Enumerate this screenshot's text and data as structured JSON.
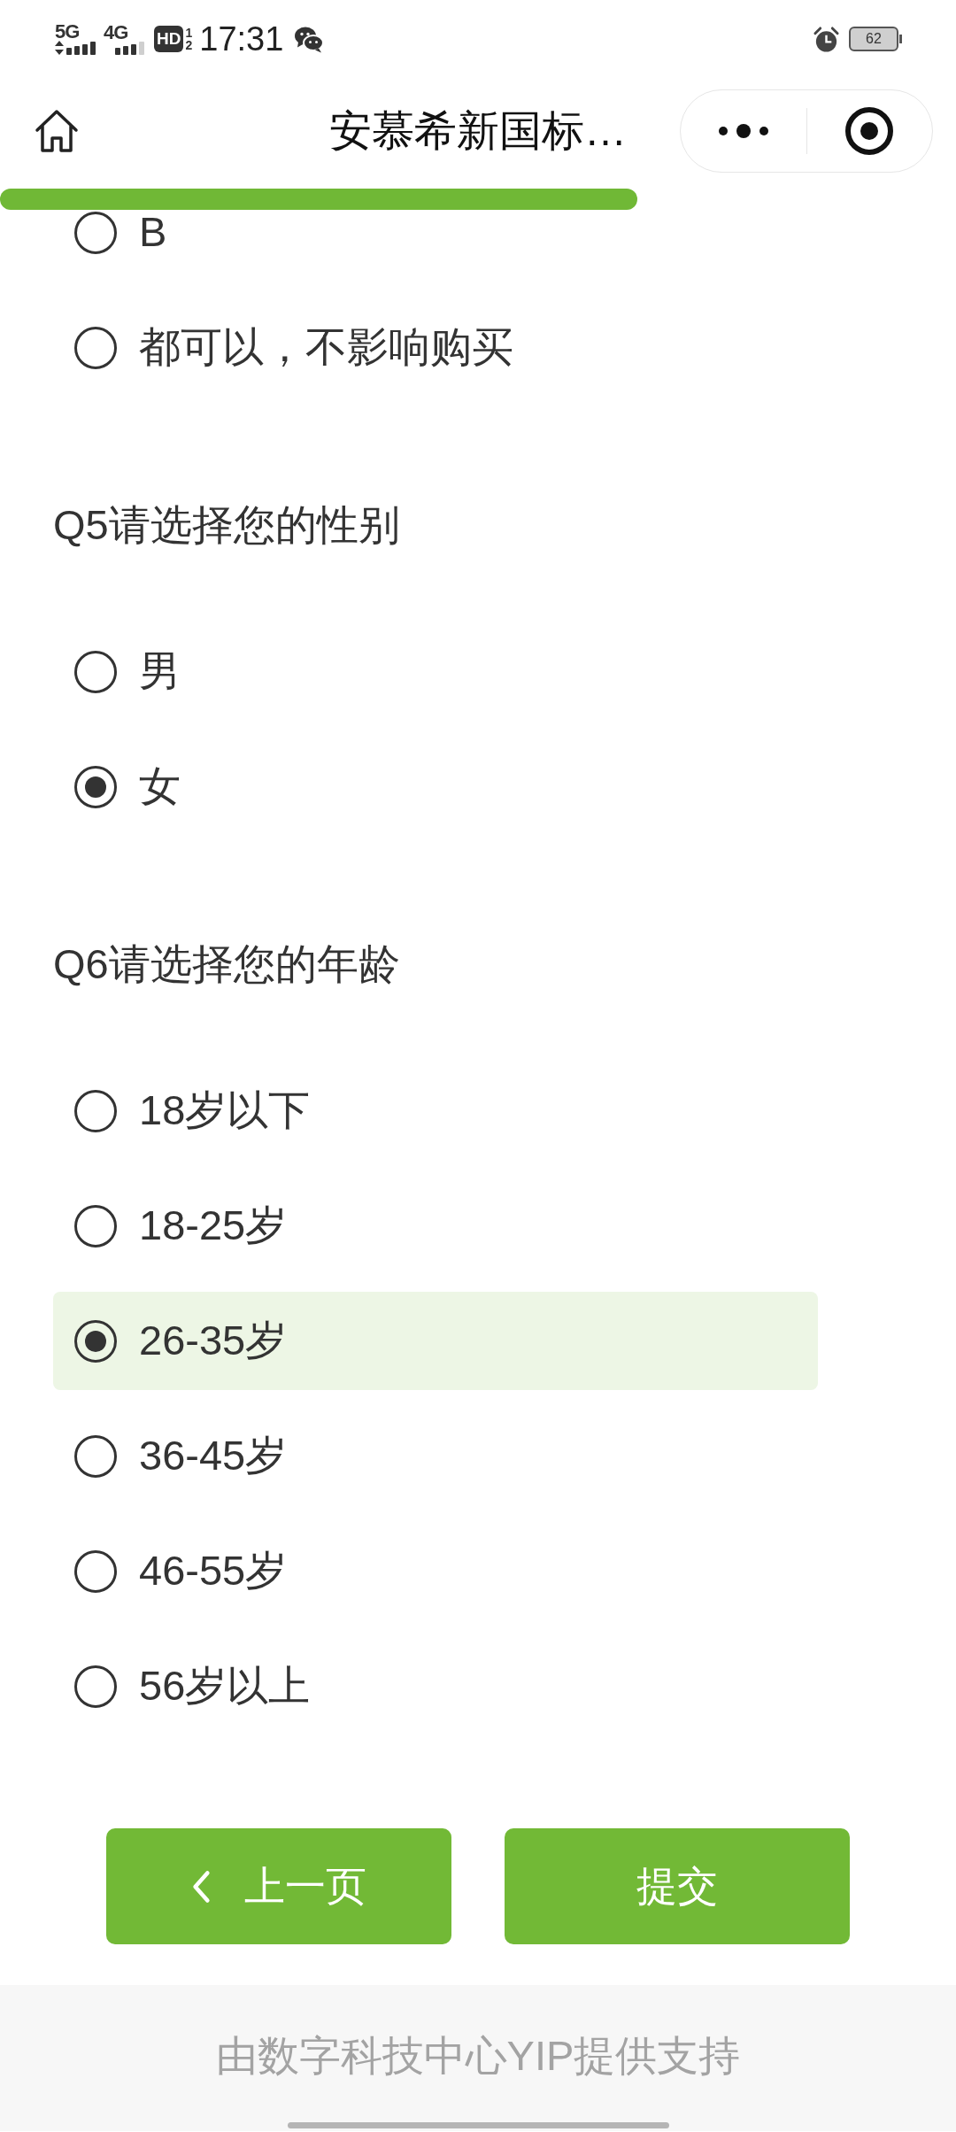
{
  "status_bar": {
    "networks": [
      {
        "label": "5G",
        "kind": "data"
      },
      {
        "label": "4G",
        "kind": "plain"
      }
    ],
    "hd": {
      "label": "HD",
      "sims": [
        "1",
        "2"
      ]
    },
    "time": "17:31",
    "battery": "62"
  },
  "header": {
    "title": "安慕希新国标…"
  },
  "progress": {
    "level": 0.667
  },
  "questions": [
    {
      "options": [
        {
          "label": "B",
          "selected": false,
          "highlighted": false
        },
        {
          "label": "都可以，不影响购买",
          "selected": false,
          "highlighted": false
        }
      ]
    },
    {
      "title": "Q5请选择您的性别",
      "options": [
        {
          "label": "男",
          "selected": false,
          "highlighted": false
        },
        {
          "label": "女",
          "selected": true,
          "highlighted": false
        }
      ]
    },
    {
      "title": "Q6请选择您的年龄",
      "options": [
        {
          "label": "18岁以下",
          "selected": false,
          "highlighted": false
        },
        {
          "label": "18-25岁",
          "selected": false,
          "highlighted": false
        },
        {
          "label": "26-35岁",
          "selected": true,
          "highlighted": true
        },
        {
          "label": "36-45岁",
          "selected": false,
          "highlighted": false
        },
        {
          "label": "46-55岁",
          "selected": false,
          "highlighted": false
        },
        {
          "label": "56岁以上",
          "selected": false,
          "highlighted": false
        }
      ]
    }
  ],
  "buttons": [
    {
      "kind": "back",
      "label": "上一页"
    },
    {
      "kind": "submit",
      "label": "提交"
    }
  ],
  "footer": {
    "text": "由数字科技中心YIP提供支持"
  }
}
